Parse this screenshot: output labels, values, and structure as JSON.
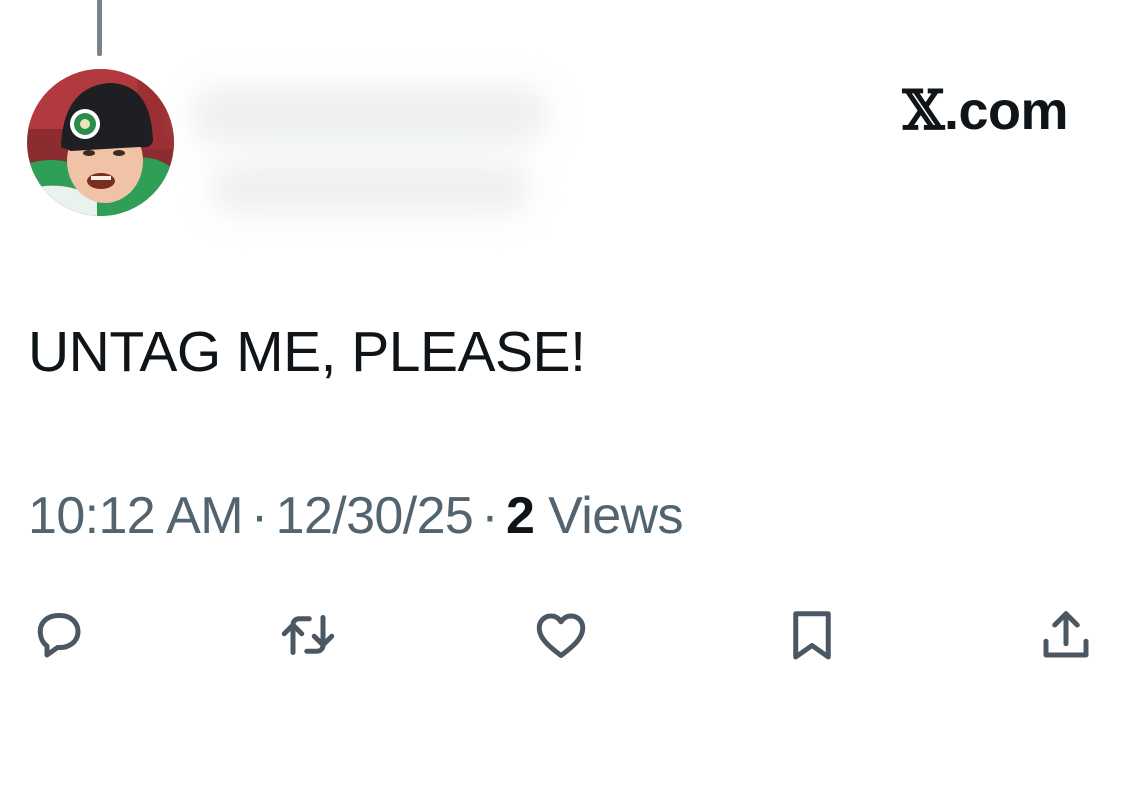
{
  "brand": {
    "prefix": "𝕏",
    "suffix": ".com"
  },
  "post": {
    "text": "UNTAG ME, PLEASE!",
    "time": "10:12 AM",
    "separator": "·",
    "date": "12/30/25",
    "views_count": "2",
    "views_label": " Views"
  },
  "actions": {
    "reply": "reply-icon",
    "repost": "repost-icon",
    "like": "heart-icon",
    "bookmark": "bookmark-icon",
    "share": "share-icon"
  },
  "colors": {
    "text_primary": "#0f1419",
    "text_secondary": "#536471",
    "icon": "#4b5864",
    "background": "#ffffff"
  }
}
